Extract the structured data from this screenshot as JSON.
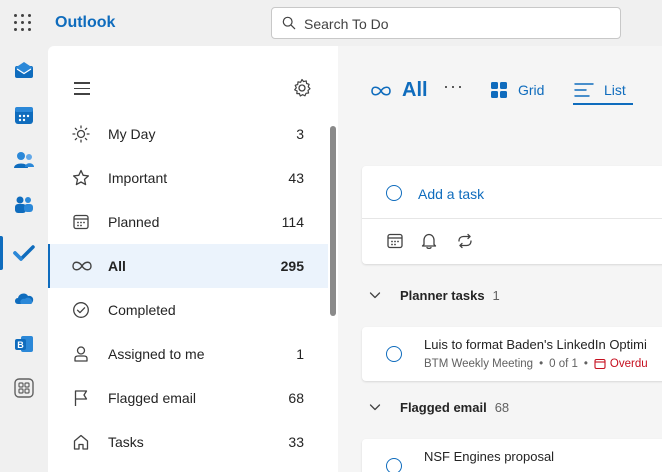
{
  "header": {
    "app_name": "Outlook",
    "search_placeholder": "Search To Do"
  },
  "rail": {
    "items": [
      "mail-icon",
      "calendar-icon",
      "people-icon",
      "teams-icon",
      "todo-icon",
      "onedrive-icon",
      "bookings-icon",
      "apps-icon"
    ],
    "active": "todo-icon"
  },
  "sidebar": {
    "items": [
      {
        "label": "My Day",
        "count": "3",
        "icon": "sun-icon"
      },
      {
        "label": "Important",
        "count": "43",
        "icon": "star-icon"
      },
      {
        "label": "Planned",
        "count": "114",
        "icon": "calendar-grid-icon"
      },
      {
        "label": "All",
        "count": "295",
        "icon": "infinity-icon",
        "active": true
      },
      {
        "label": "Completed",
        "count": "",
        "icon": "check-circle-icon"
      },
      {
        "label": "Assigned to me",
        "count": "1",
        "icon": "person-icon"
      },
      {
        "label": "Flagged email",
        "count": "68",
        "icon": "flag-icon"
      },
      {
        "label": "Tasks",
        "count": "33",
        "icon": "home-icon"
      }
    ]
  },
  "main": {
    "title": "All",
    "more": "···",
    "tabs": [
      {
        "label": "Grid"
      },
      {
        "label": "List",
        "active": true
      }
    ],
    "add_task": "Add a task",
    "groups": [
      {
        "title": "Planner tasks",
        "count": "1",
        "tasks": [
          {
            "title": "Luis to format Baden's LinkedIn Optimi",
            "source": "BTM Weekly Meeting",
            "progress": "0 of 1",
            "status": "Overdu"
          }
        ]
      },
      {
        "title": "Flagged email",
        "count": "68",
        "tasks": [
          {
            "title": "NSF Engines proposal"
          }
        ]
      }
    ]
  },
  "colors": {
    "accent": "#0f6cbd",
    "overdue": "#c50f1f"
  }
}
